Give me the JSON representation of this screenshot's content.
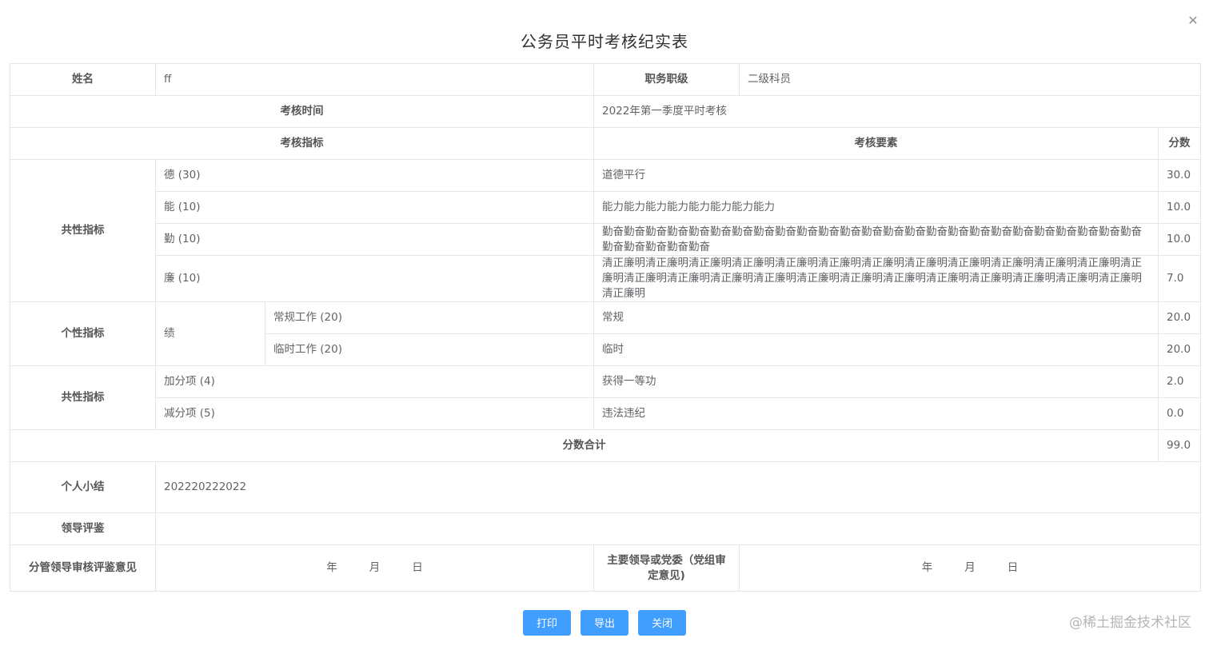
{
  "dialog": {
    "title": "公务员平时考核纪实表",
    "close_icon": "close-icon"
  },
  "form": {
    "name_label": "姓名",
    "name_value": "ff",
    "rank_label": "职务职级",
    "rank_value": "二级科员",
    "time_label": "考核时间",
    "time_value": "2022年第一季度平时考核",
    "header_indicator": "考核指标",
    "header_element": "考核要素",
    "header_score": "分数",
    "common_label": "共性指标",
    "personal_label": "个性指标",
    "common2_label": "共性指标",
    "performance_label": "绩",
    "rows": [
      {
        "indicator": "德 (30)",
        "element": "道德平行",
        "score": "30.0"
      },
      {
        "indicator": "能 (10)",
        "element": "能力能力能力能力能力能力能力能力",
        "score": "10.0"
      },
      {
        "indicator": "勤 (10)",
        "element": "勤奋勤奋勤奋勤奋勤奋勤奋勤奋勤奋勤奋勤奋勤奋勤奋勤奋勤奋勤奋勤奋勤奋勤奋勤奋勤奋勤奋勤奋勤奋勤奋勤奋勤奋勤奋勤奋勤奋勤奋",
        "score": "10.0"
      },
      {
        "indicator": "廉 (10)",
        "element": "清正廉明清正廉明清正廉明清正廉明清正廉明清正廉明清正廉明清正廉明清正廉明清正廉明清正廉明清正廉明清正廉明清正廉明清正廉明清正廉明清正廉明清正廉明清正廉明清正廉明清正廉明清正廉明清正廉明清正廉明清正廉明清正廉明",
        "score": "7.0"
      },
      {
        "indicator": "常规工作 (20)",
        "element": "常规",
        "score": "20.0"
      },
      {
        "indicator": "临时工作 (20)",
        "element": "临时",
        "score": "20.0"
      },
      {
        "indicator": "加分项 (4)",
        "element": "获得一等功",
        "score": "2.0"
      },
      {
        "indicator": "减分项 (5)",
        "element": "违法违纪",
        "score": "0.0"
      }
    ],
    "total_label": "分数合计",
    "total_value": "99.0",
    "summary_label": "个人小结",
    "summary_value": "202220222022",
    "leader_review_label": "领导评鉴",
    "leader_review_value": "",
    "sub_leader_label": "分管领导审核评鉴意见",
    "main_leader_label": "主要领导或党委（党组审定意见)",
    "date_year": "年",
    "date_month": "月",
    "date_day": "日"
  },
  "buttons": {
    "print": "打印",
    "export": "导出",
    "close": "关闭"
  },
  "watermark": "@稀土掘金技术社区",
  "colors": {
    "primary": "#409eff",
    "border": "#e6e6e6"
  }
}
